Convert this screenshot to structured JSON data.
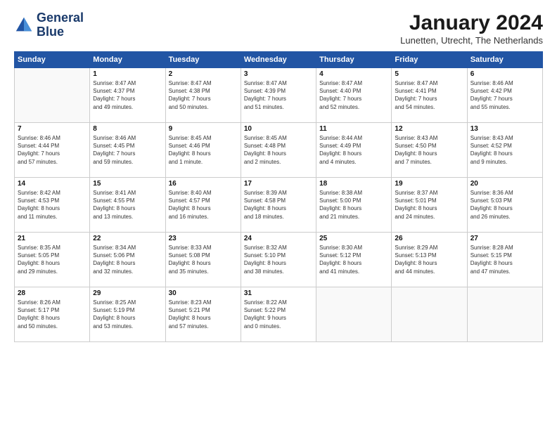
{
  "header": {
    "logo_line1": "General",
    "logo_line2": "Blue",
    "month_title": "January 2024",
    "location": "Lunetten, Utrecht, The Netherlands"
  },
  "weekdays": [
    "Sunday",
    "Monday",
    "Tuesday",
    "Wednesday",
    "Thursday",
    "Friday",
    "Saturday"
  ],
  "weeks": [
    [
      {
        "day": "",
        "info": ""
      },
      {
        "day": "1",
        "info": "Sunrise: 8:47 AM\nSunset: 4:37 PM\nDaylight: 7 hours\nand 49 minutes."
      },
      {
        "day": "2",
        "info": "Sunrise: 8:47 AM\nSunset: 4:38 PM\nDaylight: 7 hours\nand 50 minutes."
      },
      {
        "day": "3",
        "info": "Sunrise: 8:47 AM\nSunset: 4:39 PM\nDaylight: 7 hours\nand 51 minutes."
      },
      {
        "day": "4",
        "info": "Sunrise: 8:47 AM\nSunset: 4:40 PM\nDaylight: 7 hours\nand 52 minutes."
      },
      {
        "day": "5",
        "info": "Sunrise: 8:47 AM\nSunset: 4:41 PM\nDaylight: 7 hours\nand 54 minutes."
      },
      {
        "day": "6",
        "info": "Sunrise: 8:46 AM\nSunset: 4:42 PM\nDaylight: 7 hours\nand 55 minutes."
      }
    ],
    [
      {
        "day": "7",
        "info": "Sunrise: 8:46 AM\nSunset: 4:44 PM\nDaylight: 7 hours\nand 57 minutes."
      },
      {
        "day": "8",
        "info": "Sunrise: 8:46 AM\nSunset: 4:45 PM\nDaylight: 7 hours\nand 59 minutes."
      },
      {
        "day": "9",
        "info": "Sunrise: 8:45 AM\nSunset: 4:46 PM\nDaylight: 8 hours\nand 1 minute."
      },
      {
        "day": "10",
        "info": "Sunrise: 8:45 AM\nSunset: 4:48 PM\nDaylight: 8 hours\nand 2 minutes."
      },
      {
        "day": "11",
        "info": "Sunrise: 8:44 AM\nSunset: 4:49 PM\nDaylight: 8 hours\nand 4 minutes."
      },
      {
        "day": "12",
        "info": "Sunrise: 8:43 AM\nSunset: 4:50 PM\nDaylight: 8 hours\nand 7 minutes."
      },
      {
        "day": "13",
        "info": "Sunrise: 8:43 AM\nSunset: 4:52 PM\nDaylight: 8 hours\nand 9 minutes."
      }
    ],
    [
      {
        "day": "14",
        "info": "Sunrise: 8:42 AM\nSunset: 4:53 PM\nDaylight: 8 hours\nand 11 minutes."
      },
      {
        "day": "15",
        "info": "Sunrise: 8:41 AM\nSunset: 4:55 PM\nDaylight: 8 hours\nand 13 minutes."
      },
      {
        "day": "16",
        "info": "Sunrise: 8:40 AM\nSunset: 4:57 PM\nDaylight: 8 hours\nand 16 minutes."
      },
      {
        "day": "17",
        "info": "Sunrise: 8:39 AM\nSunset: 4:58 PM\nDaylight: 8 hours\nand 18 minutes."
      },
      {
        "day": "18",
        "info": "Sunrise: 8:38 AM\nSunset: 5:00 PM\nDaylight: 8 hours\nand 21 minutes."
      },
      {
        "day": "19",
        "info": "Sunrise: 8:37 AM\nSunset: 5:01 PM\nDaylight: 8 hours\nand 24 minutes."
      },
      {
        "day": "20",
        "info": "Sunrise: 8:36 AM\nSunset: 5:03 PM\nDaylight: 8 hours\nand 26 minutes."
      }
    ],
    [
      {
        "day": "21",
        "info": "Sunrise: 8:35 AM\nSunset: 5:05 PM\nDaylight: 8 hours\nand 29 minutes."
      },
      {
        "day": "22",
        "info": "Sunrise: 8:34 AM\nSunset: 5:06 PM\nDaylight: 8 hours\nand 32 minutes."
      },
      {
        "day": "23",
        "info": "Sunrise: 8:33 AM\nSunset: 5:08 PM\nDaylight: 8 hours\nand 35 minutes."
      },
      {
        "day": "24",
        "info": "Sunrise: 8:32 AM\nSunset: 5:10 PM\nDaylight: 8 hours\nand 38 minutes."
      },
      {
        "day": "25",
        "info": "Sunrise: 8:30 AM\nSunset: 5:12 PM\nDaylight: 8 hours\nand 41 minutes."
      },
      {
        "day": "26",
        "info": "Sunrise: 8:29 AM\nSunset: 5:13 PM\nDaylight: 8 hours\nand 44 minutes."
      },
      {
        "day": "27",
        "info": "Sunrise: 8:28 AM\nSunset: 5:15 PM\nDaylight: 8 hours\nand 47 minutes."
      }
    ],
    [
      {
        "day": "28",
        "info": "Sunrise: 8:26 AM\nSunset: 5:17 PM\nDaylight: 8 hours\nand 50 minutes."
      },
      {
        "day": "29",
        "info": "Sunrise: 8:25 AM\nSunset: 5:19 PM\nDaylight: 8 hours\nand 53 minutes."
      },
      {
        "day": "30",
        "info": "Sunrise: 8:23 AM\nSunset: 5:21 PM\nDaylight: 8 hours\nand 57 minutes."
      },
      {
        "day": "31",
        "info": "Sunrise: 8:22 AM\nSunset: 5:22 PM\nDaylight: 9 hours\nand 0 minutes."
      },
      {
        "day": "",
        "info": ""
      },
      {
        "day": "",
        "info": ""
      },
      {
        "day": "",
        "info": ""
      }
    ]
  ]
}
